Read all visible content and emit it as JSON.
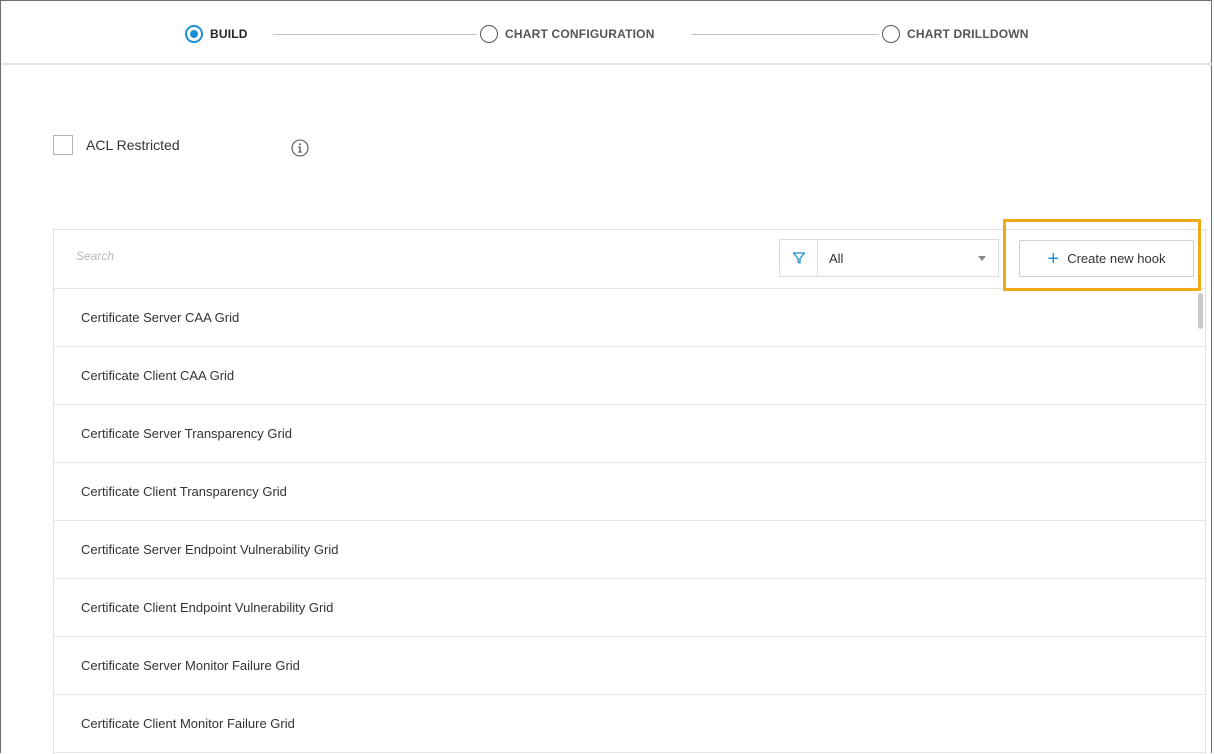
{
  "stepper": {
    "steps": [
      {
        "label": "BUILD",
        "active": true
      },
      {
        "label": "CHART CONFIGURATION",
        "active": false
      },
      {
        "label": "CHART DRILLDOWN",
        "active": false
      }
    ]
  },
  "acl": {
    "label": "ACL Restricted",
    "checked": false,
    "info_icon": "info-circle-icon"
  },
  "toolbar": {
    "search_placeholder": "Search",
    "filter_icon": "funnel-filter-icon",
    "filter_value": "All",
    "create_button_label": "Create new hook",
    "create_button_icon": "plus-icon"
  },
  "hooks": [
    "Certificate Server CAA Grid",
    "Certificate Client CAA Grid",
    "Certificate Server Transparency Grid",
    "Certificate Client Transparency Grid",
    "Certificate Server Endpoint Vulnerability Grid",
    "Certificate Client Endpoint Vulnerability Grid",
    "Certificate Server Monitor Failure Grid",
    "Certificate Client Monitor Failure Grid"
  ],
  "colors": {
    "accent": "#1a8fd8",
    "highlight": "#f0a81c"
  }
}
